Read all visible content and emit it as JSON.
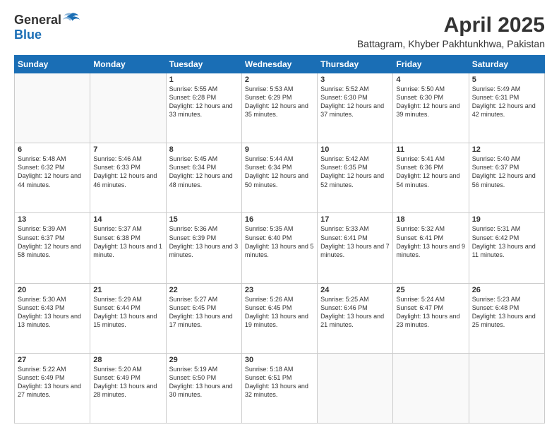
{
  "header": {
    "logo_general": "General",
    "logo_blue": "Blue",
    "title": "April 2025",
    "subtitle": "Battagram, Khyber Pakhtunkhwa, Pakistan"
  },
  "weekdays": [
    "Sunday",
    "Monday",
    "Tuesday",
    "Wednesday",
    "Thursday",
    "Friday",
    "Saturday"
  ],
  "weeks": [
    [
      {
        "day": "",
        "info": ""
      },
      {
        "day": "",
        "info": ""
      },
      {
        "day": "1",
        "info": "Sunrise: 5:55 AM\nSunset: 6:28 PM\nDaylight: 12 hours and 33 minutes."
      },
      {
        "day": "2",
        "info": "Sunrise: 5:53 AM\nSunset: 6:29 PM\nDaylight: 12 hours and 35 minutes."
      },
      {
        "day": "3",
        "info": "Sunrise: 5:52 AM\nSunset: 6:30 PM\nDaylight: 12 hours and 37 minutes."
      },
      {
        "day": "4",
        "info": "Sunrise: 5:50 AM\nSunset: 6:30 PM\nDaylight: 12 hours and 39 minutes."
      },
      {
        "day": "5",
        "info": "Sunrise: 5:49 AM\nSunset: 6:31 PM\nDaylight: 12 hours and 42 minutes."
      }
    ],
    [
      {
        "day": "6",
        "info": "Sunrise: 5:48 AM\nSunset: 6:32 PM\nDaylight: 12 hours and 44 minutes."
      },
      {
        "day": "7",
        "info": "Sunrise: 5:46 AM\nSunset: 6:33 PM\nDaylight: 12 hours and 46 minutes."
      },
      {
        "day": "8",
        "info": "Sunrise: 5:45 AM\nSunset: 6:34 PM\nDaylight: 12 hours and 48 minutes."
      },
      {
        "day": "9",
        "info": "Sunrise: 5:44 AM\nSunset: 6:34 PM\nDaylight: 12 hours and 50 minutes."
      },
      {
        "day": "10",
        "info": "Sunrise: 5:42 AM\nSunset: 6:35 PM\nDaylight: 12 hours and 52 minutes."
      },
      {
        "day": "11",
        "info": "Sunrise: 5:41 AM\nSunset: 6:36 PM\nDaylight: 12 hours and 54 minutes."
      },
      {
        "day": "12",
        "info": "Sunrise: 5:40 AM\nSunset: 6:37 PM\nDaylight: 12 hours and 56 minutes."
      }
    ],
    [
      {
        "day": "13",
        "info": "Sunrise: 5:39 AM\nSunset: 6:37 PM\nDaylight: 12 hours and 58 minutes."
      },
      {
        "day": "14",
        "info": "Sunrise: 5:37 AM\nSunset: 6:38 PM\nDaylight: 13 hours and 1 minute."
      },
      {
        "day": "15",
        "info": "Sunrise: 5:36 AM\nSunset: 6:39 PM\nDaylight: 13 hours and 3 minutes."
      },
      {
        "day": "16",
        "info": "Sunrise: 5:35 AM\nSunset: 6:40 PM\nDaylight: 13 hours and 5 minutes."
      },
      {
        "day": "17",
        "info": "Sunrise: 5:33 AM\nSunset: 6:41 PM\nDaylight: 13 hours and 7 minutes."
      },
      {
        "day": "18",
        "info": "Sunrise: 5:32 AM\nSunset: 6:41 PM\nDaylight: 13 hours and 9 minutes."
      },
      {
        "day": "19",
        "info": "Sunrise: 5:31 AM\nSunset: 6:42 PM\nDaylight: 13 hours and 11 minutes."
      }
    ],
    [
      {
        "day": "20",
        "info": "Sunrise: 5:30 AM\nSunset: 6:43 PM\nDaylight: 13 hours and 13 minutes."
      },
      {
        "day": "21",
        "info": "Sunrise: 5:29 AM\nSunset: 6:44 PM\nDaylight: 13 hours and 15 minutes."
      },
      {
        "day": "22",
        "info": "Sunrise: 5:27 AM\nSunset: 6:45 PM\nDaylight: 13 hours and 17 minutes."
      },
      {
        "day": "23",
        "info": "Sunrise: 5:26 AM\nSunset: 6:45 PM\nDaylight: 13 hours and 19 minutes."
      },
      {
        "day": "24",
        "info": "Sunrise: 5:25 AM\nSunset: 6:46 PM\nDaylight: 13 hours and 21 minutes."
      },
      {
        "day": "25",
        "info": "Sunrise: 5:24 AM\nSunset: 6:47 PM\nDaylight: 13 hours and 23 minutes."
      },
      {
        "day": "26",
        "info": "Sunrise: 5:23 AM\nSunset: 6:48 PM\nDaylight: 13 hours and 25 minutes."
      }
    ],
    [
      {
        "day": "27",
        "info": "Sunrise: 5:22 AM\nSunset: 6:49 PM\nDaylight: 13 hours and 27 minutes."
      },
      {
        "day": "28",
        "info": "Sunrise: 5:20 AM\nSunset: 6:49 PM\nDaylight: 13 hours and 28 minutes."
      },
      {
        "day": "29",
        "info": "Sunrise: 5:19 AM\nSunset: 6:50 PM\nDaylight: 13 hours and 30 minutes."
      },
      {
        "day": "30",
        "info": "Sunrise: 5:18 AM\nSunset: 6:51 PM\nDaylight: 13 hours and 32 minutes."
      },
      {
        "day": "",
        "info": ""
      },
      {
        "day": "",
        "info": ""
      },
      {
        "day": "",
        "info": ""
      }
    ]
  ]
}
